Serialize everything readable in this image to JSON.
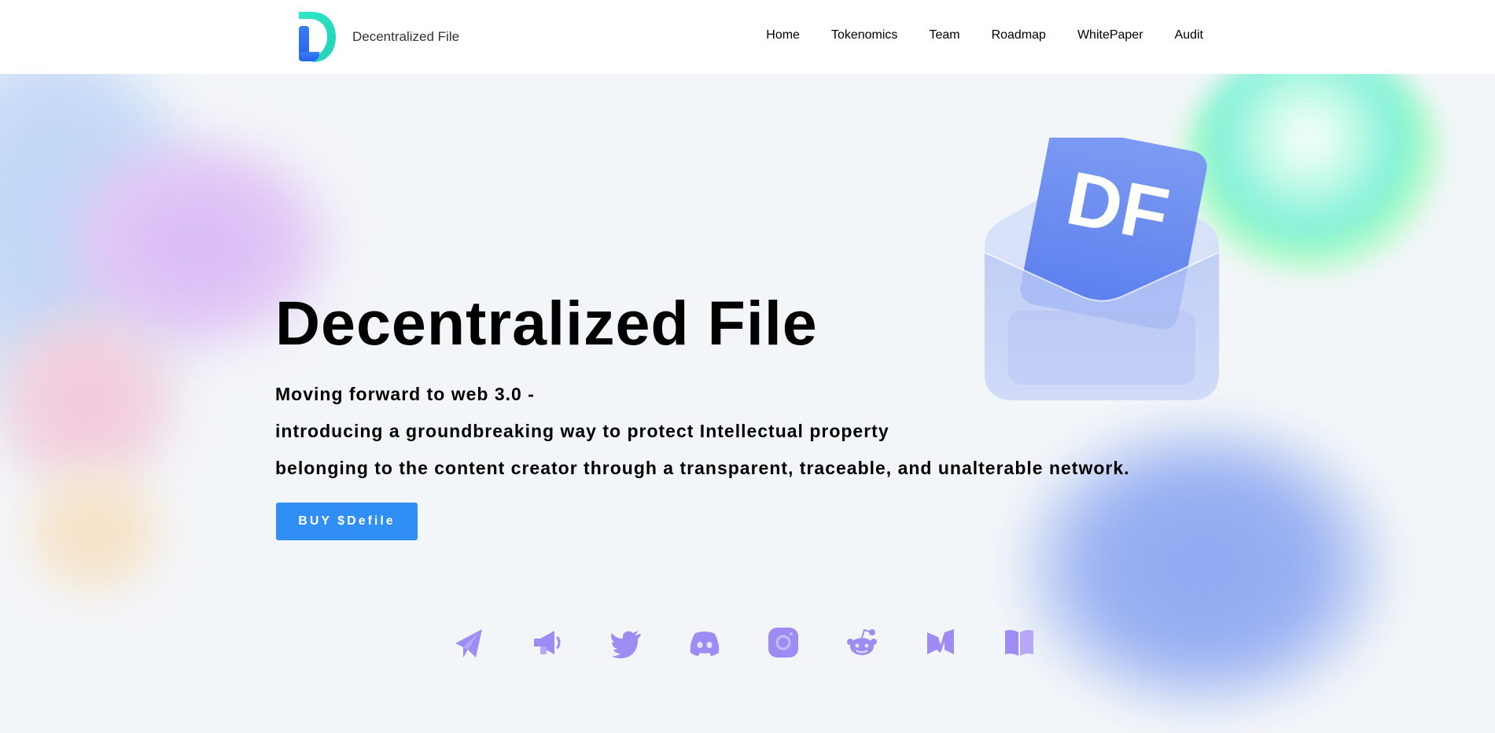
{
  "header": {
    "brand_name": "Decentralized File",
    "nav": [
      "Home",
      "Tokenomics",
      "Team",
      "Roadmap",
      "WhitePaper",
      "Audit"
    ]
  },
  "hero": {
    "title": "Decentralized File",
    "lines": [
      "Moving forward to web 3.0 -",
      "introducing a groundbreaking way to protect Intellectual property",
      "belonging to the content creator through a transparent, traceable, and unalterable network."
    ],
    "buy_label": "BUY $Defile",
    "card_text": "DF"
  },
  "socials": [
    "telegram-icon",
    "megaphone-icon",
    "twitter-icon",
    "discord-icon",
    "instagram-icon",
    "reddit-icon",
    "medium-icon",
    "book-icon"
  ],
  "colors": {
    "accent": "#2f8ff5",
    "social_icon": "#9f8cf3",
    "card": "#6b8cf0"
  }
}
